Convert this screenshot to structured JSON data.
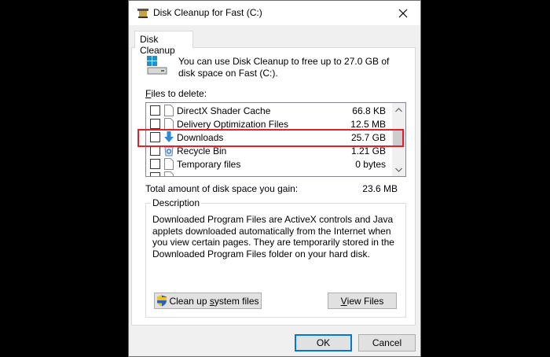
{
  "window": {
    "title": "Disk Cleanup for Fast (C:)"
  },
  "tab": {
    "label": "Disk Cleanup"
  },
  "intro": {
    "text": "You can use Disk Cleanup to free up to 27.0 GB of disk space on Fast (C:)."
  },
  "files": {
    "label_underlined": "F",
    "label_rest": "iles to delete:",
    "items": [
      {
        "name": "DirectX Shader Cache",
        "size": "66.8 KB",
        "checked": false,
        "icon": "file-icon"
      },
      {
        "name": "Delivery Optimization Files",
        "size": "12.5 MB",
        "checked": false,
        "icon": "file-icon"
      },
      {
        "name": "Downloads",
        "size": "25.7 GB",
        "checked": false,
        "icon": "download-arrow-icon"
      },
      {
        "name": "Recycle Bin",
        "size": "1.21 GB",
        "checked": false,
        "icon": "recycle-bin-icon"
      },
      {
        "name": "Temporary files",
        "size": "0 bytes",
        "checked": false,
        "icon": "file-icon"
      }
    ]
  },
  "total": {
    "label": "Total amount of disk space you gain:",
    "value": "23.6 MB"
  },
  "description": {
    "legend": "Description",
    "text": "Downloaded Program Files are ActiveX controls and Java applets downloaded automatically from the Internet when you view certain pages. They are temporarily stored in the Downloaded Program Files folder on your hard disk."
  },
  "buttons": {
    "cleanup_pre": "Clean up ",
    "cleanup_underlined": "s",
    "cleanup_post": "ystem files",
    "view_underlined": "V",
    "view_rest": "iew Files",
    "ok": "OK",
    "cancel": "Cancel"
  },
  "colors": {
    "highlight": "#e0222c",
    "ok_border": "#0078d7"
  }
}
